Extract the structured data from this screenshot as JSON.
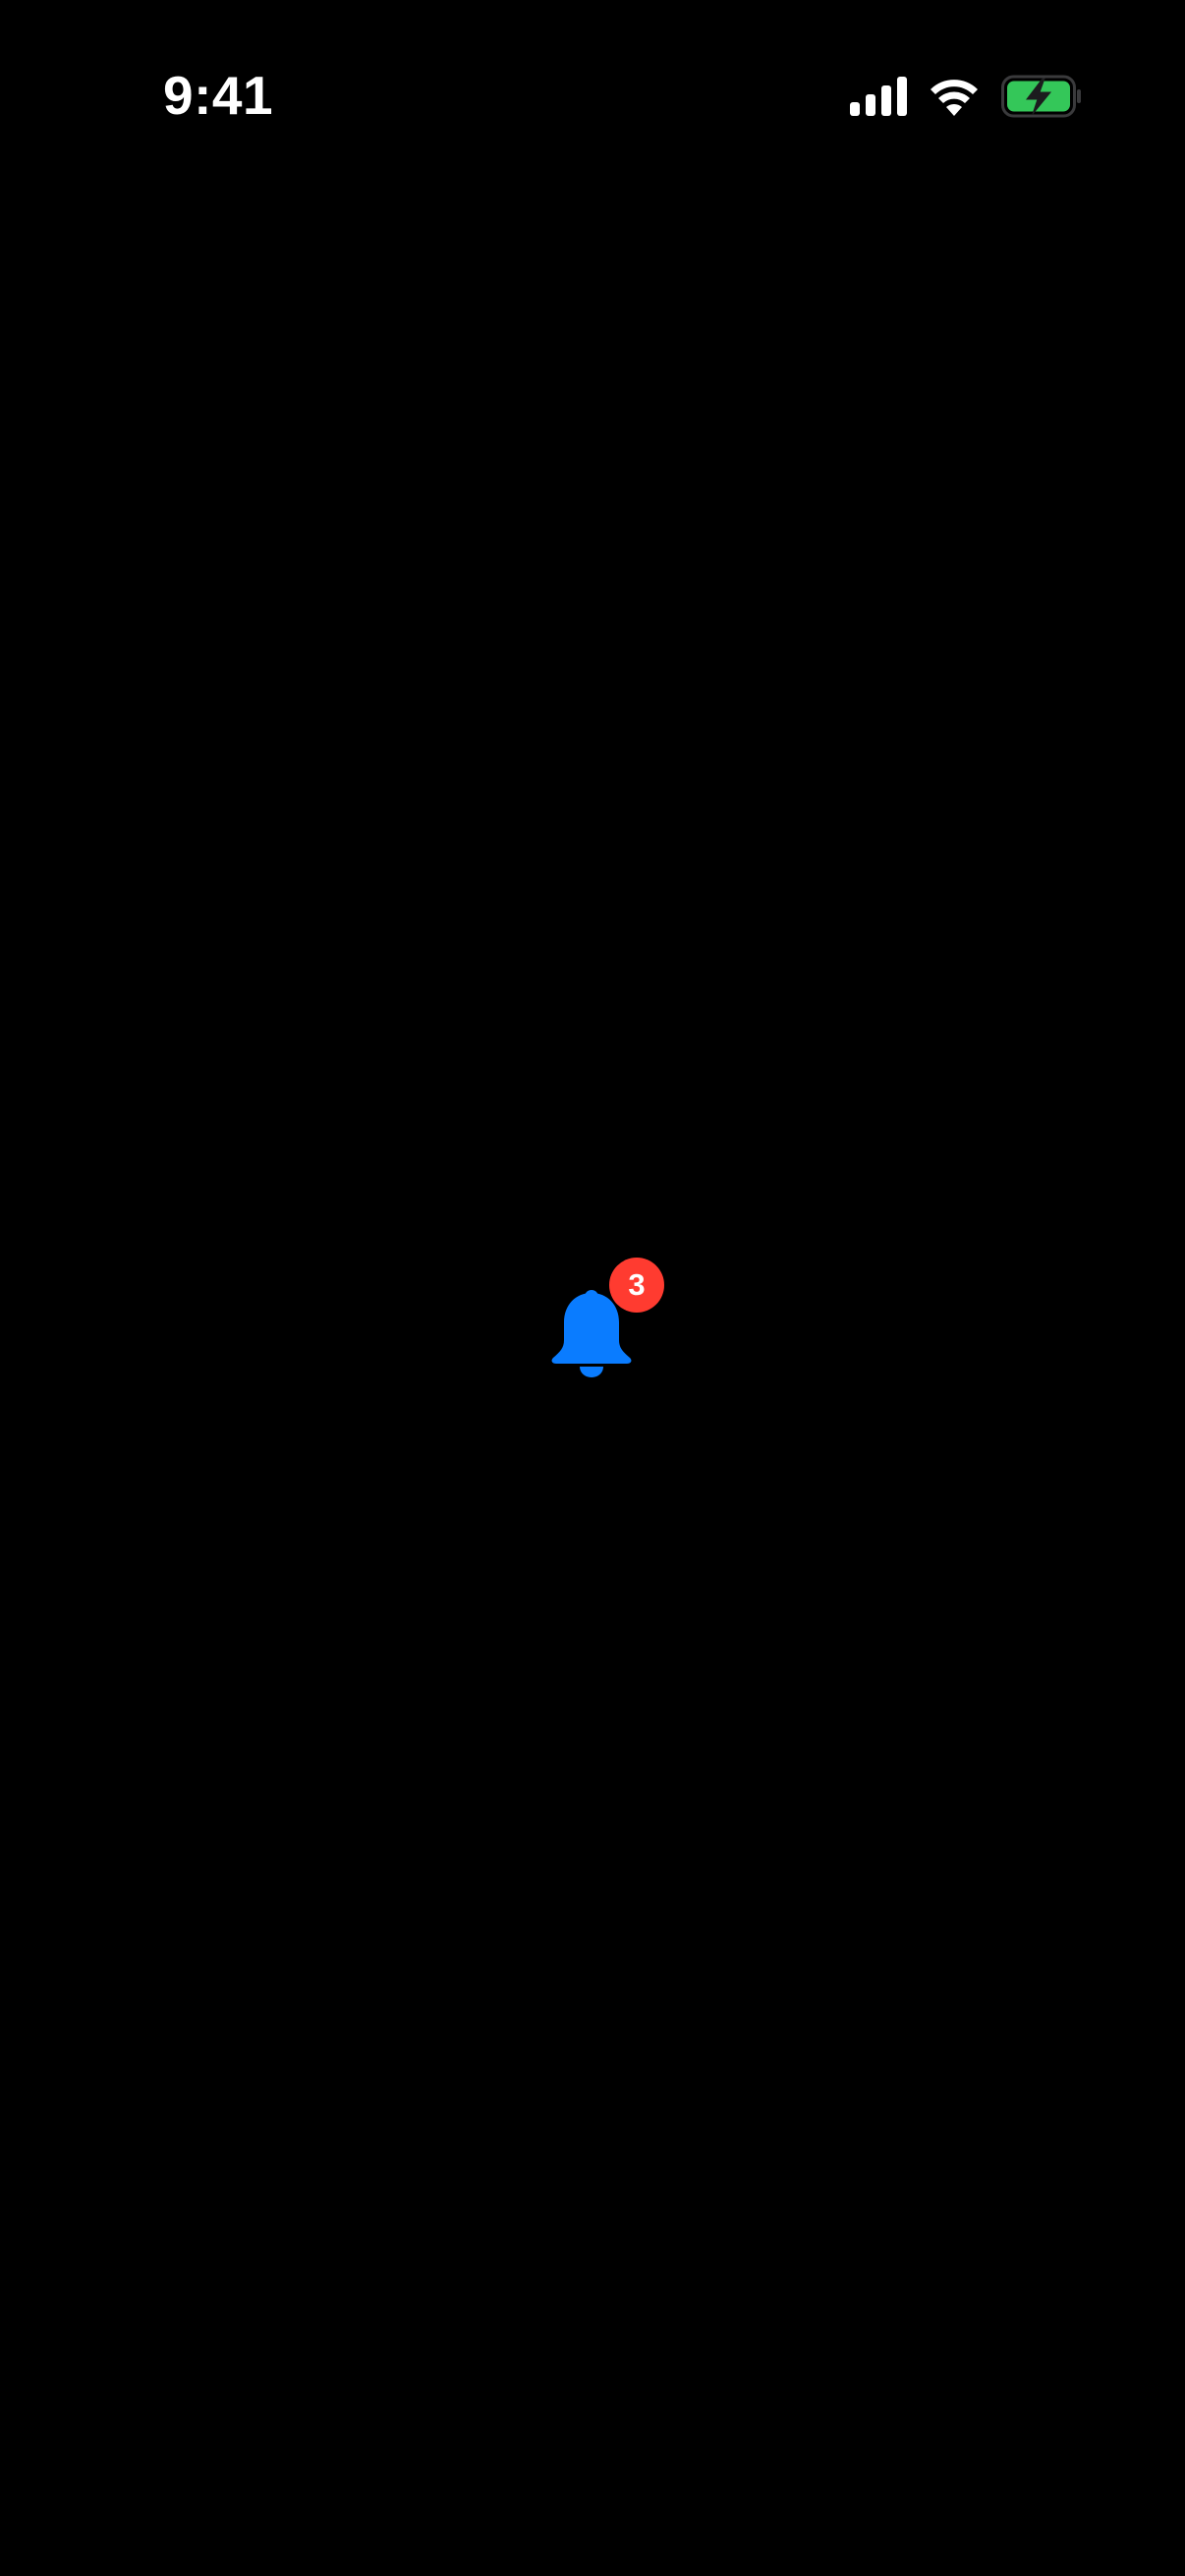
{
  "status_bar": {
    "time": "9:41",
    "icons": [
      "cellular-signal-icon",
      "wifi-icon",
      "battery-charging-icon"
    ]
  },
  "notifications": {
    "icon": "bell-icon",
    "badge_count": "3"
  },
  "colors": {
    "background": "#000000",
    "bell": "#0A7CFF",
    "badge": "#FF3B30",
    "battery_fill": "#34C759",
    "status_text": "#FFFFFF"
  }
}
